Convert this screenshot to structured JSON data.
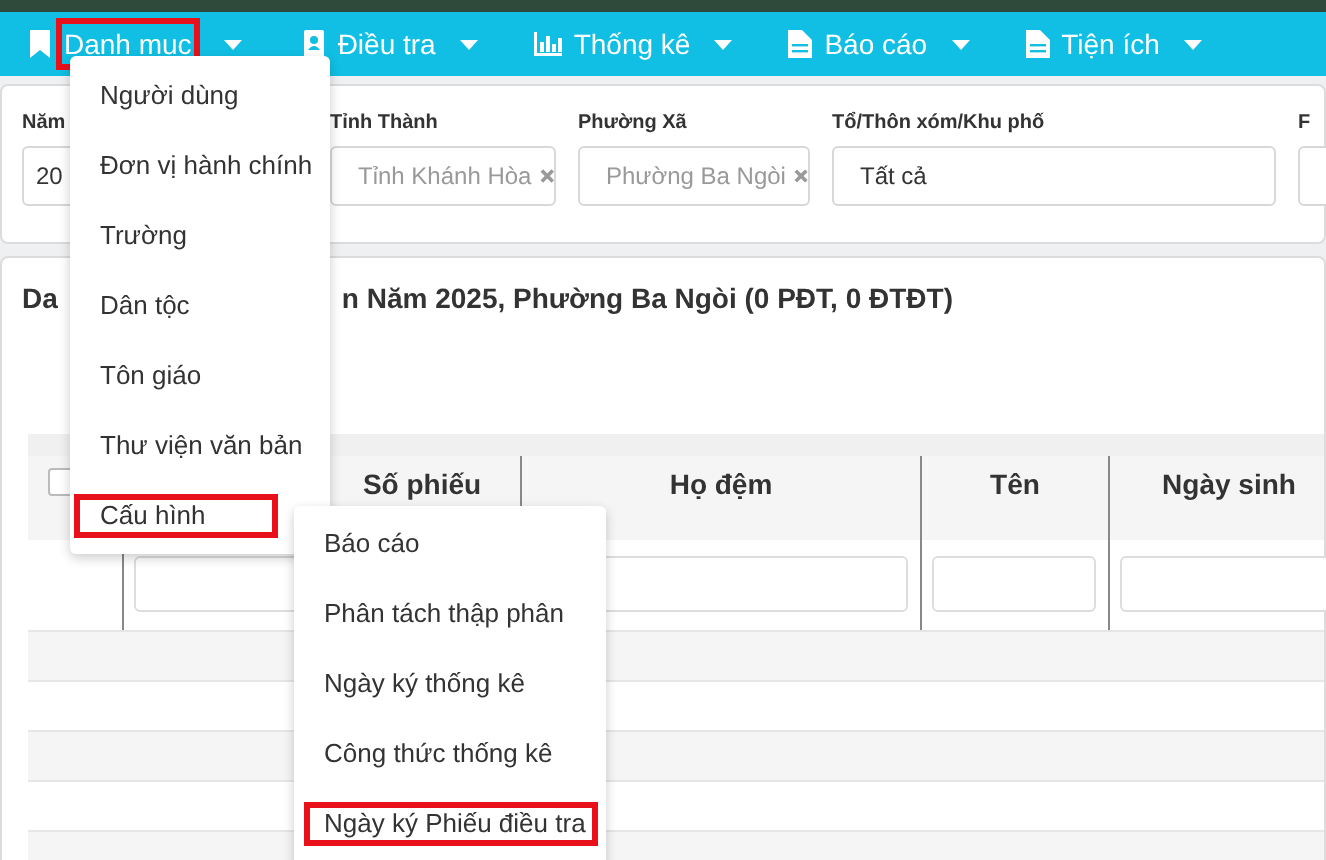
{
  "navbar": {
    "items": [
      {
        "label": "Danh mục",
        "highlighted": true
      },
      {
        "label": "Điều tra",
        "highlighted": false
      },
      {
        "label": "Thống kê",
        "highlighted": false
      },
      {
        "label": "Báo cáo",
        "highlighted": false
      },
      {
        "label": "Tiện ích",
        "highlighted": false
      }
    ]
  },
  "filters": [
    {
      "label": "Năm",
      "value": "20",
      "kind": "plain"
    },
    {
      "label": "Tỉnh Thành",
      "value": "Tỉnh Khánh Hòa",
      "kind": "locked"
    },
    {
      "label": "Phường Xã",
      "value": "Phường Ba Ngòi",
      "kind": "locked"
    },
    {
      "label": "Tổ/Thôn xóm/Khu phố",
      "value": "Tất cả",
      "kind": "plain"
    },
    {
      "label": "F",
      "kind": "plain"
    }
  ],
  "list": {
    "title_start": "Da",
    "title_end": "n Năm 2025, Phường Ba Ngòi (0 PĐT, 0 ĐTĐT)",
    "select_all": {
      "checked": false
    },
    "columns": [
      "Số phiếu",
      "Họ đệm",
      "Tên",
      "Ngày sinh"
    ]
  },
  "menu": {
    "items": [
      {
        "label": "Người dùng",
        "highlighted": false
      },
      {
        "label": "Đơn vị hành chính",
        "highlighted": false
      },
      {
        "label": "Trường",
        "highlighted": false
      },
      {
        "label": "Dân tộc",
        "highlighted": false
      },
      {
        "label": "Tôn giáo",
        "highlighted": false
      },
      {
        "label": "Thư viện văn bản",
        "highlighted": false
      },
      {
        "label": "Cấu hình",
        "highlighted": true
      }
    ]
  },
  "submenu": {
    "items": [
      {
        "label": "Báo cáo",
        "highlighted": false
      },
      {
        "label": "Phân tách thập phân",
        "highlighted": false
      },
      {
        "label": "Ngày ký thống kê",
        "highlighted": false
      },
      {
        "label": "Công thức thống kê",
        "highlighted": false
      },
      {
        "label": "Ngày ký Phiếu điều tra",
        "highlighted": true
      }
    ]
  }
}
